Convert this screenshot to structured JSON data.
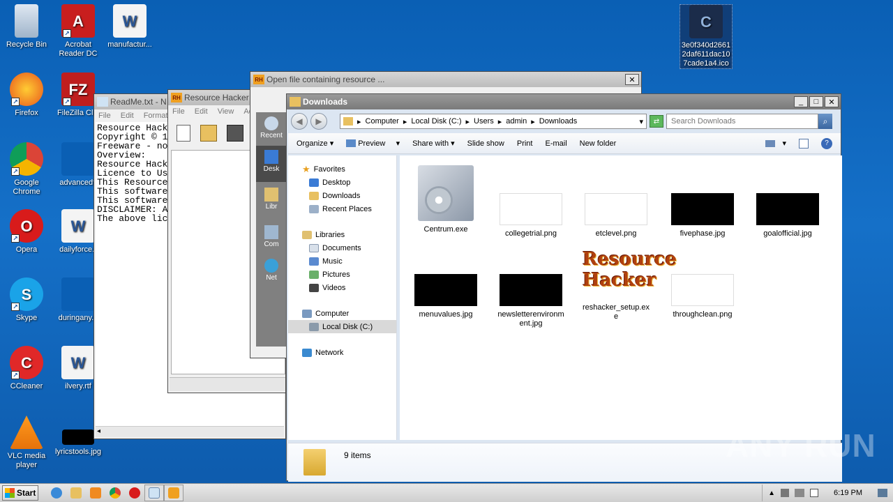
{
  "desktop": {
    "icons": [
      {
        "label": "Recycle Bin"
      },
      {
        "label": "Acrobat Reader DC"
      },
      {
        "label": "manufactur..."
      },
      {
        "label": "Firefox"
      },
      {
        "label": "FileZilla Clie"
      },
      {
        "label": "Google Chrome"
      },
      {
        "label": "advancedfi"
      },
      {
        "label": "Opera"
      },
      {
        "label": "dailyforce.r"
      },
      {
        "label": "Skype"
      },
      {
        "label": "duringany.p"
      },
      {
        "label": "CCleaner"
      },
      {
        "label": "ilvery.rtf"
      },
      {
        "label": "VLC media player"
      },
      {
        "label": "lyricstools.jpg"
      },
      {
        "label": "3e0f340d2661 2daf611dac10 7cade1a4.ico"
      }
    ]
  },
  "notepad": {
    "title": "ReadMe.txt - N",
    "menu": [
      "File",
      "Edit",
      "Format"
    ],
    "lines": [
      "Resource Hack",
      "Copyright © 1",
      "Freeware - no",
      "",
      "Overview:",
      "",
      "Resource Hack",
      "",
      "Licence to Us",
      "",
      "This Resource",
      "This software",
      "",
      "This software",
      "",
      "DISCLAIMER: A",
      "",
      "The above lic"
    ]
  },
  "reshacker": {
    "title": "Resource Hacker",
    "menu": [
      "File",
      "Edit",
      "View",
      "Act"
    ]
  },
  "opendialog": {
    "title": "Open file containing resource ...",
    "side": [
      "Recent",
      "Desk",
      "Libr",
      "Com",
      "Net"
    ]
  },
  "explorer": {
    "title": "Downloads",
    "breadcrumb": [
      "Computer",
      "Local Disk (C:)",
      "Users",
      "admin",
      "Downloads"
    ],
    "search_placeholder": "Search Downloads",
    "toolbar": {
      "organize": "Organize",
      "preview": "Preview",
      "share": "Share with",
      "slideshow": "Slide show",
      "print": "Print",
      "email": "E-mail",
      "newfolder": "New folder"
    },
    "nav": {
      "favorites": "Favorites",
      "desktop": "Desktop",
      "downloads": "Downloads",
      "recent": "Recent Places",
      "libraries": "Libraries",
      "documents": "Documents",
      "music": "Music",
      "pictures": "Pictures",
      "videos": "Videos",
      "computer": "Computer",
      "localdisk": "Local Disk (C:)",
      "network": "Network"
    },
    "files": [
      {
        "name": "Centrum.exe"
      },
      {
        "name": "collegetrial.png"
      },
      {
        "name": "etclevel.png"
      },
      {
        "name": "fivephase.jpg"
      },
      {
        "name": "goalofficial.jpg"
      },
      {
        "name": "menuvalues.jpg"
      },
      {
        "name": "newsletterenvironment.jpg"
      },
      {
        "name": "reshacker_setup.exe"
      },
      {
        "name": "throughclean.png"
      }
    ],
    "reshacker_logo_line1": "Resource",
    "reshacker_logo_line2": "Hacker",
    "item_count": "9 items"
  },
  "taskbar": {
    "start": "Start",
    "clock": "6:19 PM"
  },
  "watermark": "ANY RUN",
  "colors": {
    "desktop_bg": "#1570c8",
    "black_thumb": "#000000"
  }
}
